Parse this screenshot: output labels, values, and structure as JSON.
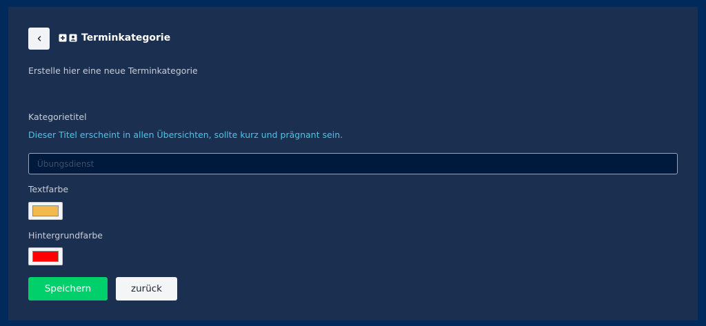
{
  "header": {
    "back_icon": "chevron-left-icon",
    "icons": [
      "plus-square-icon",
      "user-badge-icon"
    ],
    "title": "Terminkategorie",
    "subtitle": "Erstelle hier eine neue Terminkategorie"
  },
  "form": {
    "category_title": {
      "label": "Kategorietitel",
      "hint": "Dieser Titel erscheint in allen Übersichten, sollte kurz und prägnant sein.",
      "placeholder": "Übungsdienst",
      "value": ""
    },
    "text_color": {
      "label": "Textfarbe",
      "value": "#f4b94c"
    },
    "background_color": {
      "label": "Hintergrundfarbe",
      "value": "#ff0000"
    }
  },
  "actions": {
    "save_label": "Speichern",
    "back_label": "zurück"
  },
  "colors": {
    "page_background": "#002a5c",
    "panel_background": "#1b3050",
    "hint_text": "#4fc3e8",
    "save_button": "#00d06c"
  }
}
